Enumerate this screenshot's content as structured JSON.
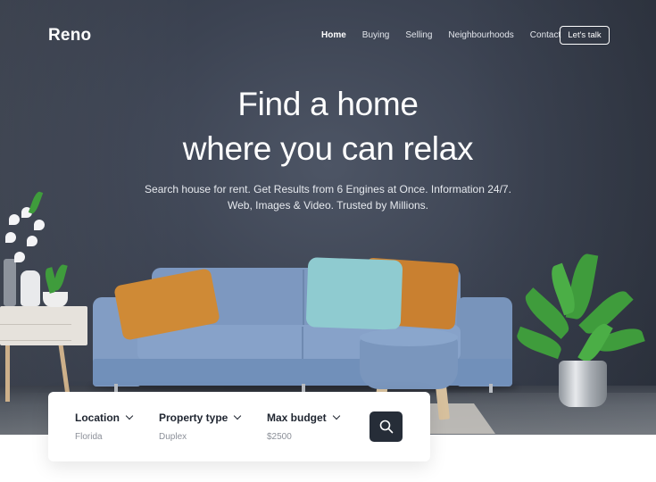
{
  "brand": "Reno",
  "nav": {
    "items": [
      {
        "label": "Home",
        "active": true
      },
      {
        "label": "Buying",
        "active": false
      },
      {
        "label": "Selling",
        "active": false
      },
      {
        "label": "Neighbourhoods",
        "active": false
      },
      {
        "label": "Contact",
        "active": false
      }
    ],
    "cta_label": "Let's talk"
  },
  "hero": {
    "headline_line1": "Find a home",
    "headline_line2": "where you can relax",
    "subtitle_line1": "Search house for rent. Get Results from 6 Engines at Once. Information 24/7.",
    "subtitle_line2": "Web, Images & Video. Trusted by Millions."
  },
  "search": {
    "fields": [
      {
        "label": "Location",
        "value": "Florida"
      },
      {
        "label": "Property type",
        "value": "Duplex"
      },
      {
        "label": "Max budget",
        "value": "$2500"
      }
    ],
    "button_icon": "search-icon"
  },
  "colors": {
    "wall": "#3c4352",
    "sofa": "#7d98c0",
    "accent_orange": "#cf8a36",
    "accent_teal": "#8fcbd0",
    "button_dark": "#262d38"
  }
}
